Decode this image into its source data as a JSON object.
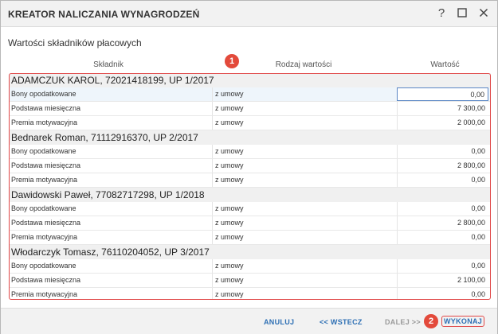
{
  "window": {
    "title": "KREATOR NALICZANIA WYNAGRODZEŃ",
    "help_label": "?"
  },
  "section_label": "Wartości składników płacowych",
  "columns": {
    "component": "Składnik",
    "value_type": "Rodzaj wartości",
    "value": "Wartość"
  },
  "employees": [
    {
      "header": "ADAMCZUK KAROL, 72021418199, UP 1/2017",
      "rows": [
        {
          "name": "Bony opodatkowane",
          "type": "z umowy",
          "value": "0,00"
        },
        {
          "name": "Podstawa miesięczna",
          "type": "z umowy",
          "value": "7 300,00"
        },
        {
          "name": "Premia motywacyjna",
          "type": "z umowy",
          "value": "2 000,00"
        }
      ]
    },
    {
      "header": "Bednarek Roman, 71112916370, UP 2/2017",
      "rows": [
        {
          "name": "Bony opodatkowane",
          "type": "z umowy",
          "value": "0,00"
        },
        {
          "name": "Podstawa miesięczna",
          "type": "z umowy",
          "value": "2 800,00"
        },
        {
          "name": "Premia motywacyjna",
          "type": "z umowy",
          "value": "0,00"
        }
      ]
    },
    {
      "header": "Dawidowski Paweł, 77082717298, UP 1/2018",
      "rows": [
        {
          "name": "Bony opodatkowane",
          "type": "z umowy",
          "value": "0,00"
        },
        {
          "name": "Podstawa miesięczna",
          "type": "z umowy",
          "value": "2 800,00"
        },
        {
          "name": "Premia motywacyjna",
          "type": "z umowy",
          "value": "0,00"
        }
      ]
    },
    {
      "header": "Włodarczyk Tomasz, 76110204052, UP 3/2017",
      "rows": [
        {
          "name": "Bony opodatkowane",
          "type": "z umowy",
          "value": "0,00"
        },
        {
          "name": "Podstawa miesięczna",
          "type": "z umowy",
          "value": "2 100,00"
        },
        {
          "name": "Premia motywacyjna",
          "type": "z umowy",
          "value": "0,00"
        }
      ]
    }
  ],
  "badges": {
    "first": "1",
    "second": "2"
  },
  "footer": {
    "cancel": "ANULUJ",
    "back": "<< WSTECZ",
    "next": "DALEJ >>",
    "execute": "WYKONAJ"
  },
  "colors": {
    "accent_link": "#2d6fb4",
    "annotation_red": "#e04848",
    "selected_row": "#eef5fb"
  }
}
